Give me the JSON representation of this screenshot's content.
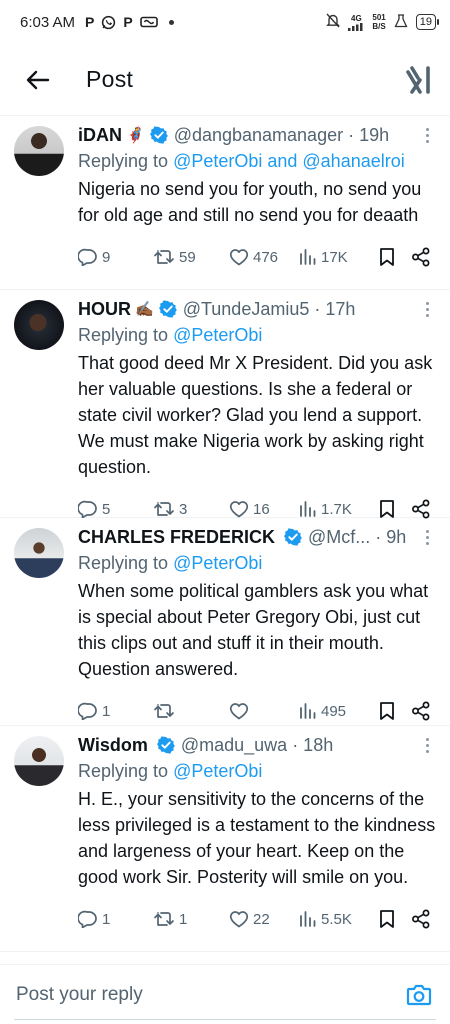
{
  "status_bar": {
    "time": "6:03 AM",
    "app_icons": [
      "P",
      "whatsapp-icon",
      "P",
      "infinity-icon"
    ],
    "network": "4G",
    "speed_value": "501",
    "speed_unit": "B/S",
    "battery": "19"
  },
  "header": {
    "title": "Post"
  },
  "tweets": [
    {
      "name": "iDAN",
      "emoji": "🦸",
      "handle": "@dangbanamanager",
      "time": "· 19h",
      "replying_prefix": "Replying to ",
      "replying_to": "@PeterObi and @ahanaelroi",
      "text": "Nigeria no send you for youth, no send you for old age and still no send you for deaath",
      "replies": "9",
      "reposts": "59",
      "likes": "476",
      "views": "17K"
    },
    {
      "name": "HOUR",
      "emoji": "✍🏾",
      "handle": "@TundeJamiu5",
      "time": "· 17h",
      "replying_prefix": "Replying to ",
      "replying_to": "@PeterObi",
      "text": "That good deed Mr X President.  Did you ask her valuable questions. Is she a federal or state civil worker? Glad you lend a support.  We must make Nigeria work by asking right question.",
      "replies": "5",
      "reposts": "3",
      "likes": "16",
      "views": "1.7K"
    },
    {
      "name": "CHARLES FREDERICK",
      "emoji": "",
      "handle": "@Mcf...",
      "time": "· 9h",
      "replying_prefix": "Replying to ",
      "replying_to": "@PeterObi",
      "text": "When some political gamblers ask you what is special about Peter Gregory Obi, just cut this clips out and  stuff it in their mouth. Question answered.",
      "replies": "1",
      "reposts": "",
      "likes": "",
      "views": "495"
    },
    {
      "name": "Wisdom",
      "emoji": "",
      "handle": "@madu_uwa",
      "time": "· 18h",
      "replying_prefix": "Replying to ",
      "replying_to": "@PeterObi",
      "text": "H. E., your sensitivity to the concerns of the less privileged is a testament to the kindness and largeness of your heart. Keep on the good work Sir. Posterity will smile on you.",
      "replies": "1",
      "reposts": "1",
      "likes": "22",
      "views": "5.5K"
    }
  ],
  "reply_bar": {
    "placeholder": "Post your reply"
  },
  "colors": {
    "accent": "#1d9bf0",
    "muted": "#536471",
    "text": "#0f1419",
    "divider": "#eff3f4"
  }
}
